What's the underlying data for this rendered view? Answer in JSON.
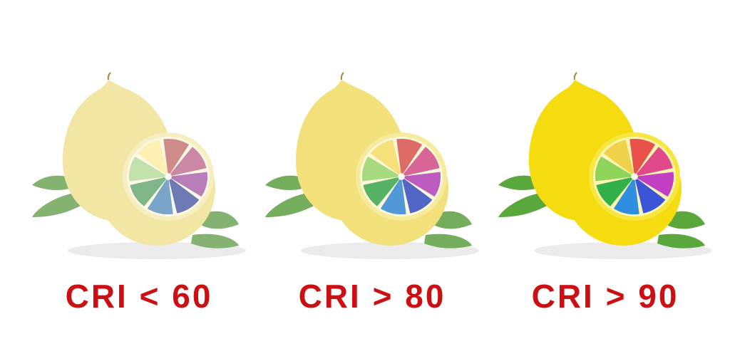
{
  "colors": {
    "label_color": "#cc0f12",
    "leaf_color": "#5aa83c",
    "wheel_segments": [
      "#e8524a",
      "#e04a8a",
      "#c23fc4",
      "#3b55d6",
      "#2f8ee0",
      "#34b04a",
      "#8fd45a",
      "#f0d24a"
    ]
  },
  "panels": [
    {
      "label": "CRI < 60",
      "lemon_color": "#f2e6a4",
      "rind_color": "#f7eebf",
      "saturation": 0.45
    },
    {
      "label": "CRI > 80",
      "lemon_color": "#f2e07a",
      "rind_color": "#f6ea9c",
      "saturation": 0.75
    },
    {
      "label": "CRI > 90",
      "lemon_color": "#f4dc10",
      "rind_color": "#f8e640",
      "saturation": 1.0
    }
  ]
}
